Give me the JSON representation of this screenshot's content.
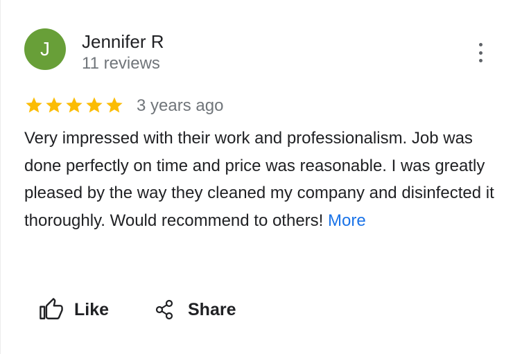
{
  "reviewer": {
    "initial": "J",
    "name": "Jennifer R",
    "reviews_count": "11 reviews",
    "avatar_color": "#689f38"
  },
  "review": {
    "rating": 5,
    "max_rating": 5,
    "time_ago": "3 years ago",
    "text": "Very impressed with their work and professionalism. Job was done perfectly on time and price was reasonable. I was greatly pleased by the way they cleaned my company and disinfected it thoroughly. Would recommend to others!",
    "more_label": "More"
  },
  "actions": {
    "like_label": "Like",
    "share_label": "Share"
  },
  "icons": {
    "menu": "more-vert-icon",
    "like": "thumb-up-icon",
    "share": "share-icon",
    "star": "star-icon"
  },
  "colors": {
    "star": "#fbbc04",
    "link": "#1a73e8",
    "secondary_text": "#70757a"
  }
}
